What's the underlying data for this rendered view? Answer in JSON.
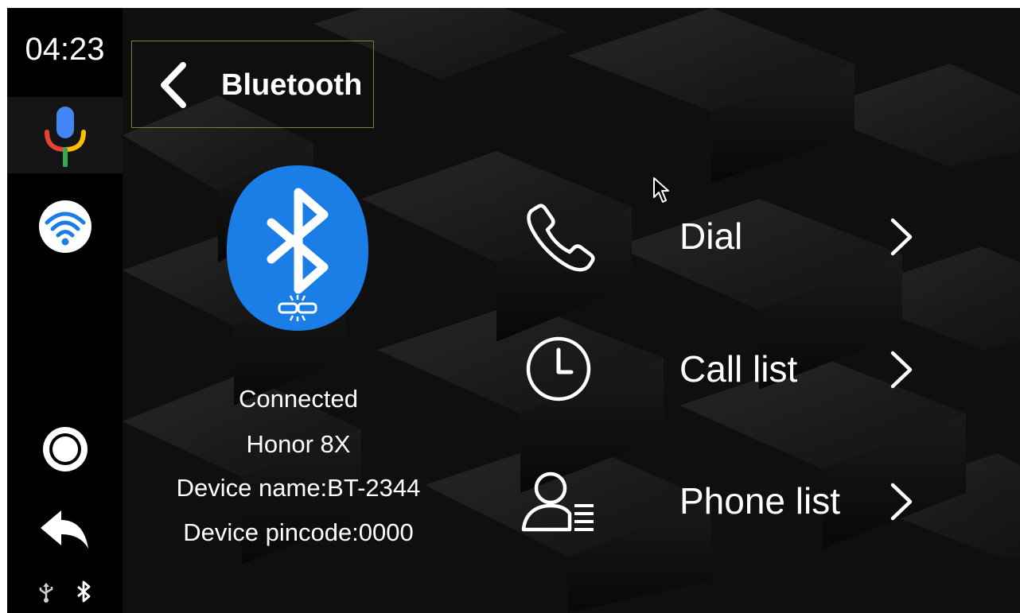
{
  "status_bar": {
    "time": "04:23"
  },
  "rail": {
    "items": [
      {
        "icon": "microphone-icon",
        "active": true
      },
      {
        "icon": "wifi-icon"
      },
      {
        "icon": "home-circle-icon"
      },
      {
        "icon": "back-arrow-icon"
      }
    ],
    "status_icons": [
      "usb-icon",
      "bluetooth-icon"
    ]
  },
  "header": {
    "title": "Bluetooth",
    "back_icon": "chevron-left-icon"
  },
  "device": {
    "status": "Connected",
    "model": "Honor 8X",
    "name": "Device name:BT-2344",
    "pincode": "Device pincode:0000",
    "badge_icon": "bluetooth-link-icon",
    "badge_color": "#1a7ee6"
  },
  "menu": {
    "items": [
      {
        "label": "Dial",
        "icon": "phone-icon"
      },
      {
        "label": "Call list",
        "icon": "clock-icon"
      },
      {
        "label": "Phone list",
        "icon": "contacts-icon"
      }
    ]
  }
}
